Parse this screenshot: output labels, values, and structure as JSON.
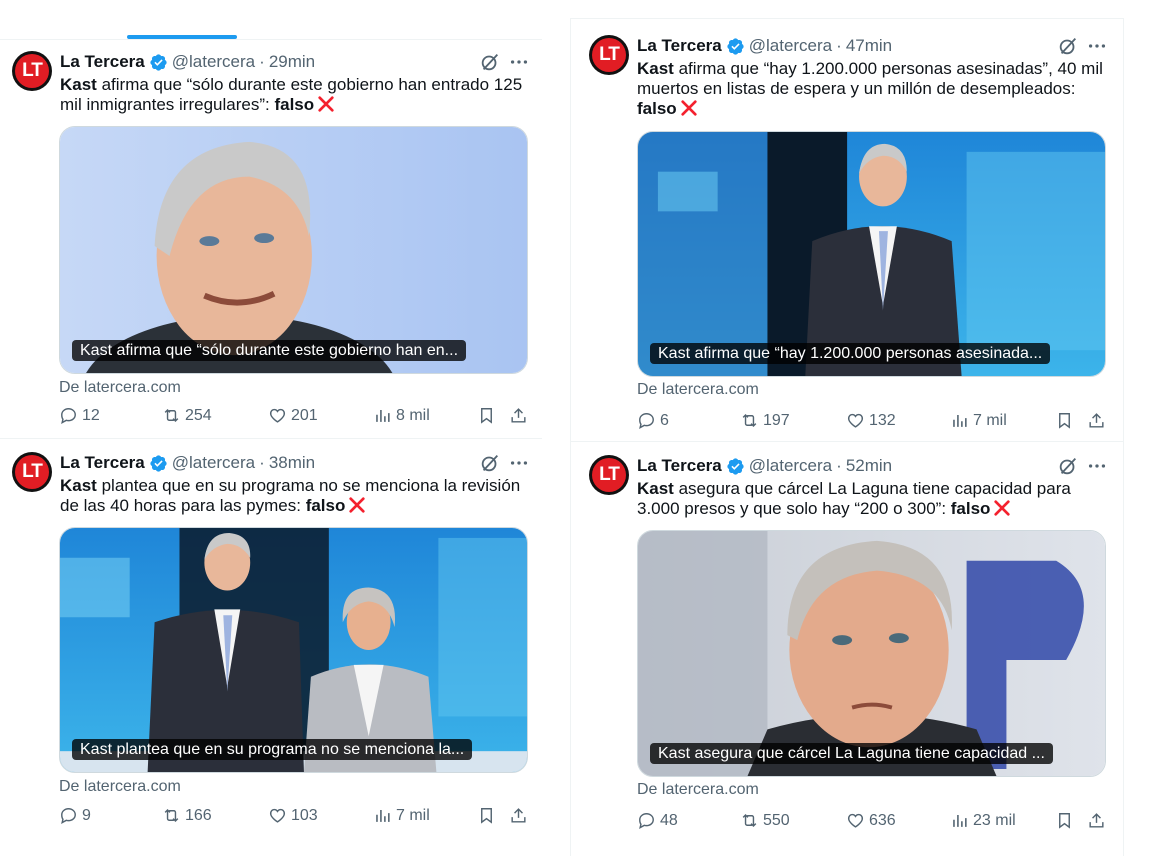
{
  "colors": {
    "accent": "#1d9bf0",
    "muted": "#536471",
    "border": "#cfd9de",
    "danger": "#f4212e",
    "brand": "#e11d24"
  },
  "tweets": [
    {
      "avatar_text": "LT",
      "name": "La Tercera",
      "handle": "@latercera",
      "separator": "·",
      "time": "29min",
      "text_bold": "Kast",
      "text": " afirma que “sólo durante este gobierno han entrado 125 mil inmigrantes irregulares”: ",
      "verdict": "falso",
      "caption": "Kast afirma que “sólo durante este gobierno han en...",
      "source": "De latercera.com",
      "replies": "12",
      "reposts": "254",
      "likes": "201",
      "views": "8 mil"
    },
    {
      "avatar_text": "LT",
      "name": "La Tercera",
      "handle": "@latercera",
      "separator": "·",
      "time": "47min",
      "text_bold": "Kast",
      "text": " afirma que “hay 1.200.000 personas asesinadas”, 40 mil muertos en listas de espera y un millón de desempleados: ",
      "verdict": "falso",
      "caption": "Kast afirma que “hay 1.200.000 personas asesinada...",
      "source": "De latercera.com",
      "replies": "6",
      "reposts": "197",
      "likes": "132",
      "views": "7 mil"
    },
    {
      "avatar_text": "LT",
      "name": "La Tercera",
      "handle": "@latercera",
      "separator": "·",
      "time": "38min",
      "text_bold": "Kast",
      "text": " plantea que en su programa no se menciona la revisión de las 40 horas para las pymes: ",
      "verdict": "falso",
      "caption": "Kast plantea que en su programa no se menciona la...",
      "source": "De latercera.com",
      "replies": "9",
      "reposts": "166",
      "likes": "103",
      "views": "7 mil"
    },
    {
      "avatar_text": "LT",
      "name": "La Tercera",
      "handle": "@latercera",
      "separator": "·",
      "time": "52min",
      "text_bold": "Kast",
      "text": " asegura que cárcel La Laguna tiene capacidad para 3.000 presos y que solo hay “200 o 300”: ",
      "verdict": "falso",
      "caption": "Kast asegura que cárcel La Laguna tiene capacidad ...",
      "source": "De latercera.com",
      "replies": "48",
      "reposts": "550",
      "likes": "636",
      "views": "23 mil"
    }
  ]
}
